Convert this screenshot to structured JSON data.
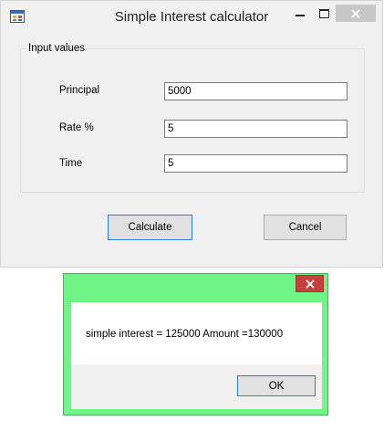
{
  "main_window": {
    "title": "Simple Interest calculator",
    "group_label": "Input values",
    "fields": [
      {
        "label": "Principal",
        "value": "5000"
      },
      {
        "label": "Rate %",
        "value": "5"
      },
      {
        "label": "Time",
        "value": "5"
      }
    ],
    "buttons": {
      "calculate": "Calculate",
      "cancel": "Cancel"
    }
  },
  "message_box": {
    "message": "simple interest = 125000 Amount =130000",
    "ok_label": "OK",
    "frame_color": "#6ff585"
  }
}
